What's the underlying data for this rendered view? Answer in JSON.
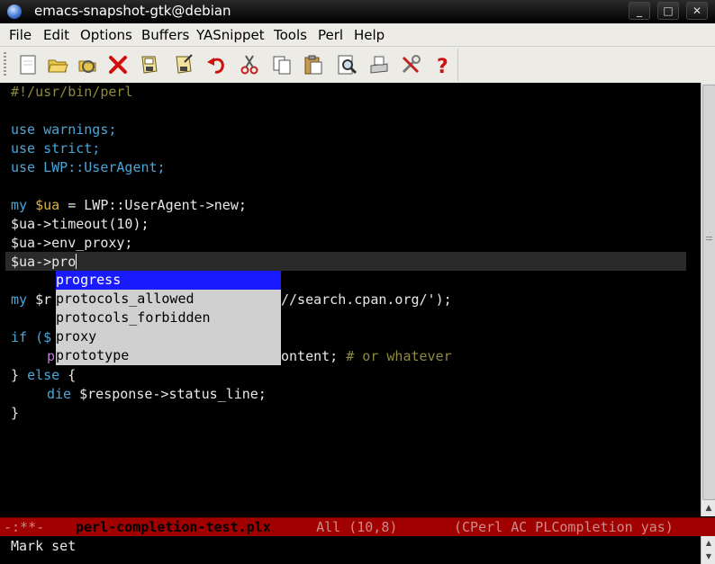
{
  "window": {
    "title": "emacs-snapshot-gtk@debian",
    "minimize_glyph": "_",
    "maximize_glyph": "□",
    "close_glyph": "✕"
  },
  "menubar": {
    "items": [
      "File",
      "Edit",
      "Options",
      "Buffers",
      "YASnippet",
      "Tools",
      "Perl",
      "Help"
    ]
  },
  "toolbar": {
    "icons": [
      "new-file-icon",
      "open-folder-icon",
      "dired-icon",
      "close-buffer-icon",
      "save-icon",
      "save-as-icon",
      "undo-icon",
      "cut-icon",
      "copy-icon",
      "paste-icon",
      "search-icon",
      "print-icon",
      "customize-icon",
      "help-icon"
    ]
  },
  "editor": {
    "lines": {
      "shebang": "#!/usr/bin/perl",
      "use_kw1": "use",
      "use_arg1": " warnings;",
      "use_kw2": "use",
      "use_arg2": " strict;",
      "use_kw3": "use",
      "use_arg3": " LWP::UserAgent;",
      "my_kw": "my",
      "ua_var": " $ua",
      "ua_rest": " = LWP::UserAgent->new;",
      "timeout": "$ua->timeout(10);",
      "env_proxy": "$ua->env_proxy;",
      "current": "$ua->pro",
      "get_my": "my",
      "get_partial": " $r",
      "get_rest": "//search.cpan.org/');",
      "if_partial": "if ($",
      "print_p": "p",
      "print_rest": "ontent; ",
      "print_comment": "# or whatever",
      "else_brace": "} ",
      "else_kw": "else",
      "else_open": " {",
      "die_kw": "die",
      "die_rest": " $response->status_line;",
      "close_brace": "}"
    },
    "completion": {
      "options": [
        "progress",
        "protocols_allowed",
        "protocols_forbidden",
        "proxy",
        "prototype"
      ],
      "selected_index": 0
    }
  },
  "modeline": {
    "status": "-:**-  ",
    "buffer": "perl-completion-test.plx",
    "position": "   All (10,8)    ",
    "modes": "(CPerl AC PLCompletion yas)"
  },
  "echo_area": {
    "message": "Mark set"
  },
  "colors": {
    "keyword": "#4aa6d8",
    "comment": "#8d8b3d",
    "variable": "#d8b53a",
    "selection": "#1a1aff",
    "modeline_bg": "#a00000"
  }
}
